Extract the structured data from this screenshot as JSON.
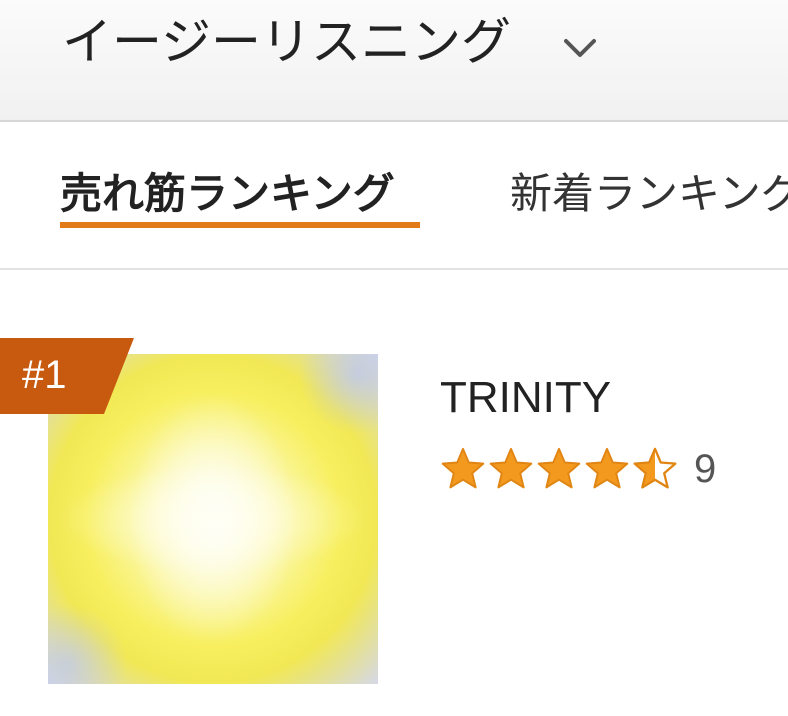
{
  "header": {
    "genre_title": "イージーリスニング",
    "chevron_icon": "chevron-down-icon"
  },
  "tabs": [
    {
      "label": "売れ筋ランキング",
      "active": true
    },
    {
      "label": "新着ランキング",
      "active": false
    }
  ],
  "colors": {
    "accent": "#e07b17",
    "badge": "#c85a10",
    "star": "#f39a1e"
  },
  "ranking_items": [
    {
      "rank_label": "#1",
      "title": "TRINITY",
      "rating_stars": 4.5,
      "rating_count": "9"
    }
  ]
}
